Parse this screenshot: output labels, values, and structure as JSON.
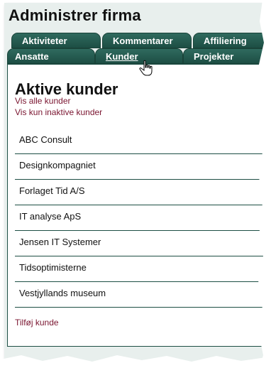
{
  "header": {
    "title": "Administrer firma"
  },
  "tabs": {
    "row1": [
      {
        "label": "Aktiviteter"
      },
      {
        "label": "Kommentarer"
      },
      {
        "label": "Affiliering"
      }
    ],
    "row2": [
      {
        "label": "Ansatte"
      },
      {
        "label": "Kunder"
      },
      {
        "label": "Projekter"
      }
    ]
  },
  "main": {
    "heading": "Aktive kunder",
    "show_all_label": "Vis alle kunder",
    "show_inactive_label": "Vis kun inaktive kunder",
    "customers": [
      "ABC Consult",
      "Designkompagniet",
      "Forlaget Tid A/S",
      "IT analyse ApS",
      "Jensen IT Systemer",
      "Tidsoptimisterne",
      "Vestjyllands museum"
    ],
    "add_customer_label": "Tilføj kunde"
  },
  "colors": {
    "tab_bg": "#1d4e44",
    "link": "#7a1530",
    "frame_bg": "#e8efed"
  },
  "icons": {
    "cursor": "hand-pointer-icon"
  }
}
